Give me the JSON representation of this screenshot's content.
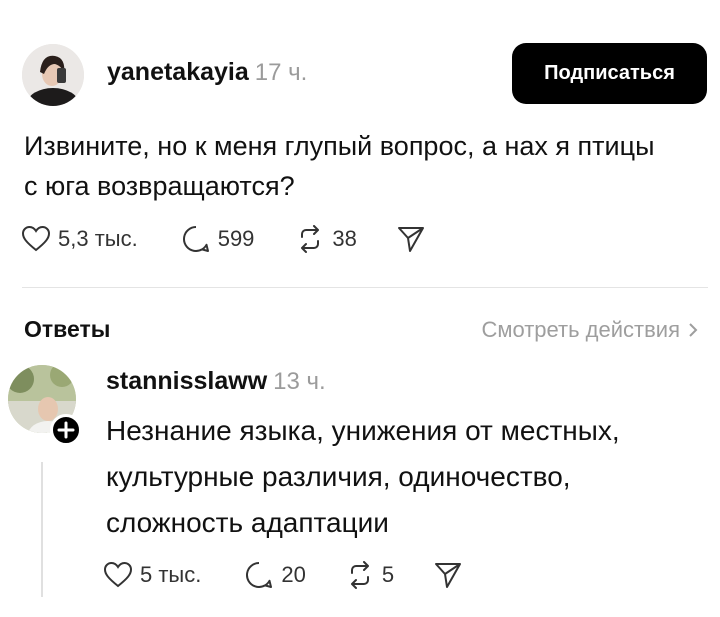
{
  "post": {
    "username": "yanetakayia",
    "time": "17 ч.",
    "follow_label": "Подписаться",
    "text_line1": "Извините, но к меня глупый вопрос, а нах  я птицы",
    "text_line2": "с юга возвращаются?",
    "likes": "5,3 тыс.",
    "comments": "599",
    "reposts": "38"
  },
  "replies": {
    "title": "Ответы",
    "view_activity": "Смотреть действия",
    "items": [
      {
        "username": "stannisslaww",
        "time": "13 ч.",
        "text_line1": "Незнание языка, унижения от местных,",
        "text_line2": "культурные различия, одиночество,",
        "text_line3": "сложность адаптации",
        "likes": "5 тыс.",
        "comments": "20",
        "reposts": "5"
      }
    ]
  },
  "icons": {
    "like": "heart-icon",
    "comment": "comment-bubble-icon",
    "repost": "repost-icon",
    "share": "send-icon",
    "chevron": "chevron-right-icon",
    "follow_badge": "plus-icon"
  },
  "colors": {
    "follow_button_bg": "#000000",
    "muted_text": "#9b9b9b"
  }
}
